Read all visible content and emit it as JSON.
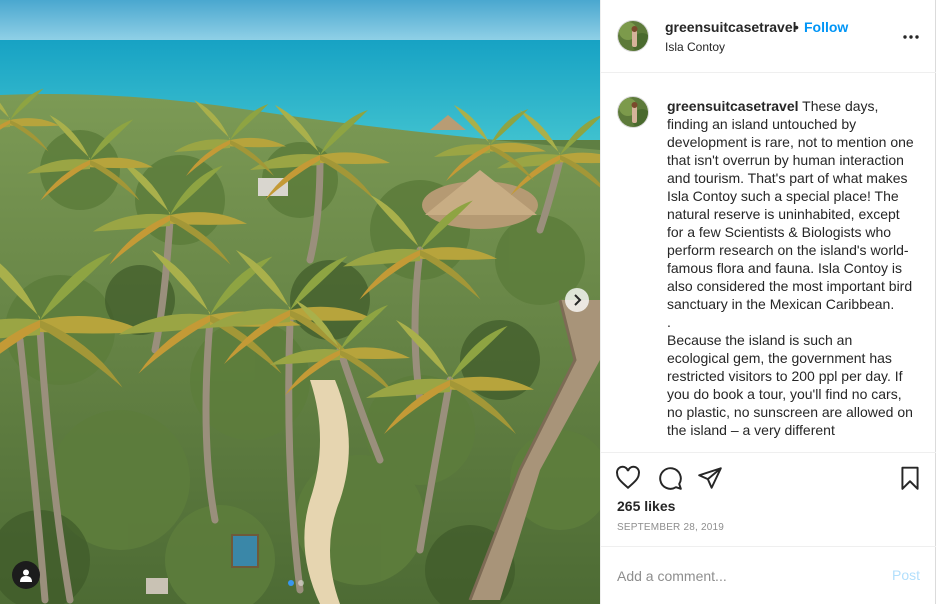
{
  "photo": {
    "alt_icon_names": [
      "chevron-right-icon",
      "user-tag-icon"
    ],
    "carousel_dots": 2
  },
  "header": {
    "username": "greensuitcasetravel",
    "dot": "•",
    "follow_label": "Follow",
    "location": "Isla Contoy"
  },
  "caption": {
    "username": "greensuitcasetravel",
    "text": " These days, finding an island untouched by development is rare, not to mention one that isn't overrun by human interaction and tourism. That's part of what makes Isla Contoy such a special place! The natural reserve is uninhabited, except for a few Scientists & Biologists who perform research on the island's world-famous flora and fauna. Isla Contoy is also considered the most important bird sanctuary in the Mexican Caribbean.\n.\nBecause the island is such an ecological gem, the government has restricted visitors to 200 ppl per day. If you do book a tour, you'll find no cars, no plastic, no sunscreen are allowed on the island – a very different"
  },
  "actions": {
    "icons": [
      "heart-icon",
      "comment-icon",
      "share-icon",
      "bookmark-icon"
    ]
  },
  "likes": "265 likes",
  "date": "SEPTEMBER 28, 2019",
  "comment": {
    "placeholder": "Add a comment...",
    "post_label": "Post"
  },
  "colors": {
    "accent": "#0095f6",
    "post_disabled": "#b2dffc",
    "sea": "#2bb3c8",
    "sky": "#3fa6c9"
  }
}
